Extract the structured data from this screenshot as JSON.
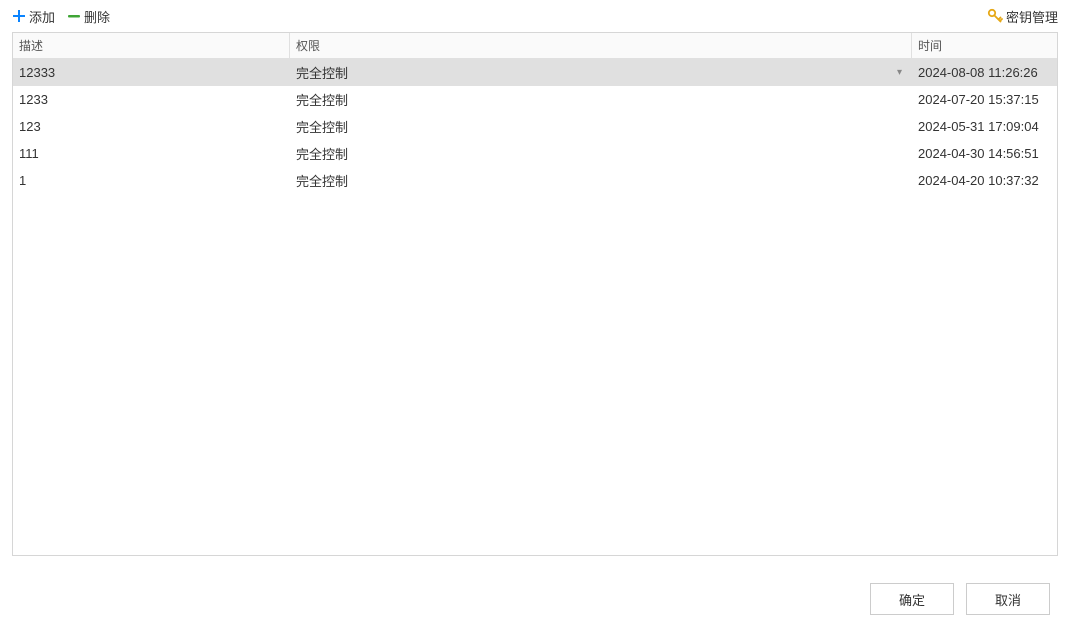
{
  "toolbar": {
    "add_label": "添加",
    "delete_label": "删除",
    "key_mgmt_label": "密钥管理"
  },
  "table": {
    "headers": {
      "description": "描述",
      "permission": "权限",
      "time": "时间"
    },
    "rows": [
      {
        "description": "12333",
        "permission": "完全控制",
        "time": "2024-08-08 11:26:26",
        "selected": true
      },
      {
        "description": "1233",
        "permission": "完全控制",
        "time": "2024-07-20 15:37:15",
        "selected": false
      },
      {
        "description": "123",
        "permission": "完全控制",
        "time": "2024-05-31 17:09:04",
        "selected": false
      },
      {
        "description": "111",
        "permission": "完全控制",
        "time": "2024-04-30 14:56:51",
        "selected": false
      },
      {
        "description": "1",
        "permission": "完全控制",
        "time": "2024-04-20 10:37:32",
        "selected": false
      }
    ]
  },
  "footer": {
    "ok_label": "确定",
    "cancel_label": "取消"
  }
}
